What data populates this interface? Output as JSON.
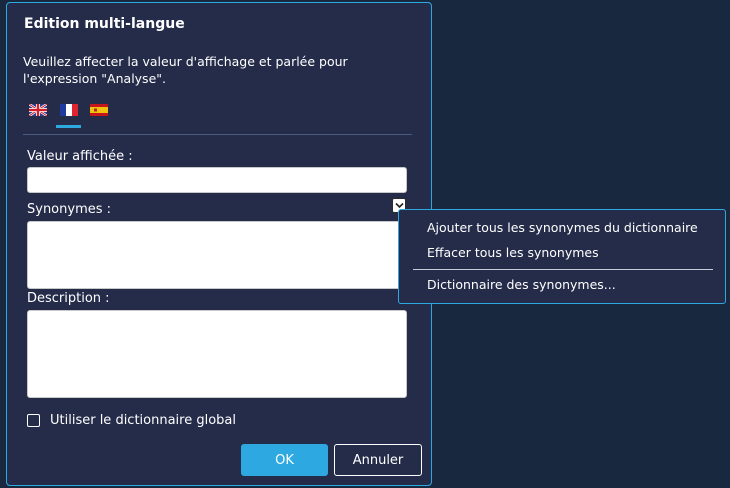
{
  "dialog": {
    "title": "Edition multi-langue",
    "instruction": "Veuillez affecter la valeur d'affichage et parlée pour l'expression \"Analyse\"."
  },
  "languages": [
    {
      "icon": "uk-flag-icon",
      "active": false
    },
    {
      "icon": "france-flag-icon",
      "active": true
    },
    {
      "icon": "spain-flag-icon",
      "active": false
    }
  ],
  "fields": {
    "displayed_value_label": "Valeur affichée :",
    "displayed_value": "",
    "synonyms_label": "Synonymes :",
    "synonyms_value": "",
    "description_label": "Description :",
    "description_value": ""
  },
  "options": {
    "global_dictionary_label": "Utiliser le dictionnaire global",
    "global_dictionary_checked": false
  },
  "buttons": {
    "ok": "OK",
    "cancel": "Annuler"
  },
  "context_menu": {
    "add_all": "Ajouter tous les synonymes du dictionnaire",
    "clear_all": "Effacer tous les synonymes",
    "dictionary": "Dictionnaire des synonymes..."
  },
  "colors": {
    "background": "#18283f",
    "dialog": "#252c4a",
    "accent": "#2ea8e0"
  }
}
